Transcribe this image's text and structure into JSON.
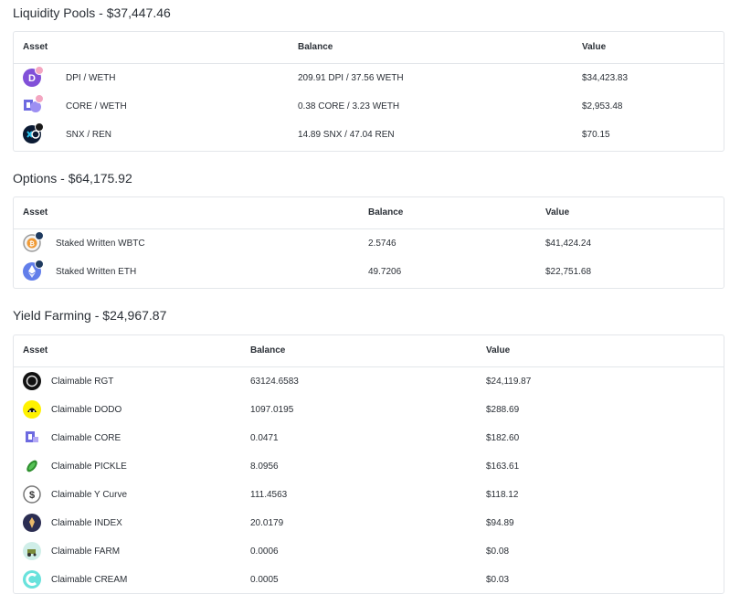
{
  "liquidity": {
    "title": "Liquidity Pools - $37,447.46",
    "headers": {
      "asset": "Asset",
      "balance": "Balance",
      "value": "Value"
    },
    "rows": [
      {
        "asset": "DPI / WETH",
        "balance": "209.91 DPI / 37.56 WETH",
        "value": "$34,423.83",
        "icon": "dpi-weth-icon"
      },
      {
        "asset": "CORE / WETH",
        "balance": "0.38 CORE / 3.23 WETH",
        "value": "$2,953.48",
        "icon": "core-weth-icon"
      },
      {
        "asset": "SNX / REN",
        "balance": "14.89 SNX / 47.04 REN",
        "value": "$70.15",
        "icon": "snx-ren-icon"
      }
    ]
  },
  "options": {
    "title": "Options - $64,175.92",
    "headers": {
      "asset": "Asset",
      "balance": "Balance",
      "value": "Value"
    },
    "rows": [
      {
        "asset": "Staked Written WBTC",
        "balance": "2.5746",
        "value": "$41,424.24",
        "icon": "wbtc-icon"
      },
      {
        "asset": "Staked Written ETH",
        "balance": "49.7206",
        "value": "$22,751.68",
        "icon": "eth-icon"
      }
    ]
  },
  "yield": {
    "title": "Yield Farming - $24,967.87",
    "headers": {
      "asset": "Asset",
      "balance": "Balance",
      "value": "Value"
    },
    "rows": [
      {
        "asset": "Claimable RGT",
        "balance": "63124.6583",
        "value": "$24,119.87",
        "icon": "rgt-icon"
      },
      {
        "asset": "Claimable DODO",
        "balance": "1097.0195",
        "value": "$288.69",
        "icon": "dodo-icon"
      },
      {
        "asset": "Claimable CORE",
        "balance": "0.0471",
        "value": "$182.60",
        "icon": "core-icon"
      },
      {
        "asset": "Claimable PICKLE",
        "balance": "8.0956",
        "value": "$163.61",
        "icon": "pickle-icon"
      },
      {
        "asset": "Claimable Y Curve",
        "balance": "111.4563",
        "value": "$118.12",
        "icon": "y-curve-icon"
      },
      {
        "asset": "Claimable INDEX",
        "balance": "20.0179",
        "value": "$94.89",
        "icon": "index-icon"
      },
      {
        "asset": "Claimable FARM",
        "balance": "0.0006",
        "value": "$0.08",
        "icon": "farm-icon"
      },
      {
        "asset": "Claimable CREAM",
        "balance": "0.0005",
        "value": "$0.03",
        "icon": "cream-icon"
      }
    ]
  }
}
